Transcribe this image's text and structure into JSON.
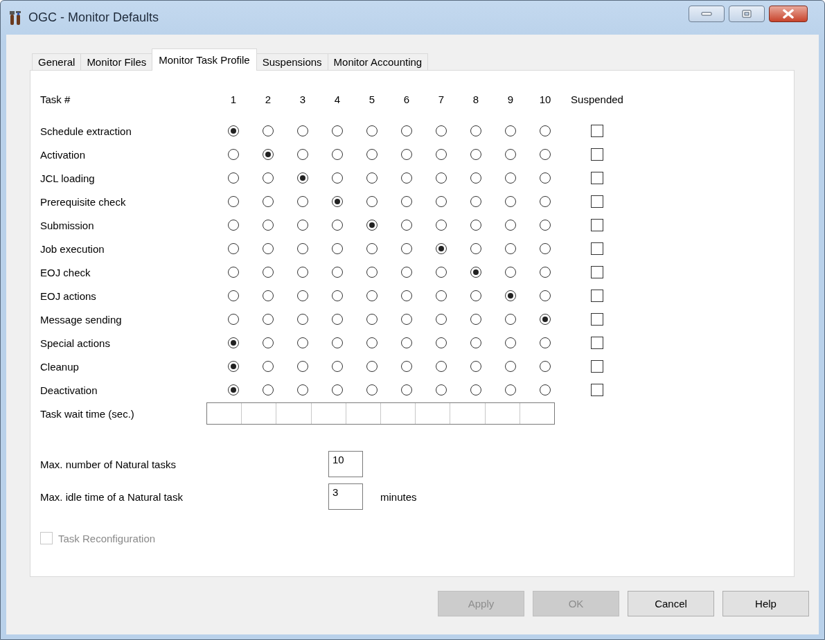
{
  "window": {
    "title": "OGC - Monitor Defaults"
  },
  "tabs": [
    {
      "label": "General",
      "selected": false
    },
    {
      "label": "Monitor Files",
      "selected": false
    },
    {
      "label": "Monitor Task Profile",
      "selected": true
    },
    {
      "label": "Suspensions",
      "selected": false
    },
    {
      "label": "Monitor Accounting",
      "selected": false
    }
  ],
  "task_grid": {
    "header_label": "Task #",
    "task_numbers": [
      "1",
      "2",
      "3",
      "4",
      "5",
      "6",
      "7",
      "8",
      "9",
      "10"
    ],
    "suspended_header": "Suspended",
    "rows": [
      {
        "label": "Schedule extraction",
        "options": [
          {
            "selected": true
          },
          {
            "selected": false
          },
          {
            "selected": false
          },
          {
            "selected": false
          },
          {
            "selected": false
          },
          {
            "selected": false
          },
          {
            "selected": false
          },
          {
            "selected": false
          },
          {
            "selected": false
          },
          {
            "selected": false
          }
        ],
        "suspended": false
      },
      {
        "label": "Activation",
        "options": [
          {
            "selected": false
          },
          {
            "selected": true
          },
          {
            "selected": false
          },
          {
            "selected": false
          },
          {
            "selected": false
          },
          {
            "selected": false
          },
          {
            "selected": false
          },
          {
            "selected": false
          },
          {
            "selected": false
          },
          {
            "selected": false
          }
        ],
        "suspended": false
      },
      {
        "label": "JCL loading",
        "options": [
          {
            "selected": false
          },
          {
            "selected": false
          },
          {
            "selected": true
          },
          {
            "selected": false
          },
          {
            "selected": false
          },
          {
            "selected": false
          },
          {
            "selected": false
          },
          {
            "selected": false
          },
          {
            "selected": false
          },
          {
            "selected": false
          }
        ],
        "suspended": false
      },
      {
        "label": "Prerequisite check",
        "options": [
          {
            "selected": false
          },
          {
            "selected": false
          },
          {
            "selected": false
          },
          {
            "selected": true
          },
          {
            "selected": false
          },
          {
            "selected": false
          },
          {
            "selected": false
          },
          {
            "selected": false
          },
          {
            "selected": false
          },
          {
            "selected": false
          }
        ],
        "suspended": false
      },
      {
        "label": "Submission",
        "options": [
          {
            "selected": false
          },
          {
            "selected": false
          },
          {
            "selected": false
          },
          {
            "selected": false
          },
          {
            "selected": true
          },
          {
            "selected": false
          },
          {
            "selected": false
          },
          {
            "selected": false
          },
          {
            "selected": false
          },
          {
            "selected": false
          }
        ],
        "suspended": false
      },
      {
        "label": "Job execution",
        "options": [
          {
            "selected": false
          },
          {
            "selected": false
          },
          {
            "selected": false
          },
          {
            "selected": false
          },
          {
            "selected": false
          },
          {
            "selected": false
          },
          {
            "selected": true
          },
          {
            "selected": false
          },
          {
            "selected": false
          },
          {
            "selected": false
          }
        ],
        "suspended": false
      },
      {
        "label": "EOJ check",
        "options": [
          {
            "selected": false
          },
          {
            "selected": false
          },
          {
            "selected": false
          },
          {
            "selected": false
          },
          {
            "selected": false
          },
          {
            "selected": false
          },
          {
            "selected": false
          },
          {
            "selected": true
          },
          {
            "selected": false
          },
          {
            "selected": false
          }
        ],
        "suspended": false
      },
      {
        "label": "EOJ actions",
        "options": [
          {
            "selected": false
          },
          {
            "selected": false
          },
          {
            "selected": false
          },
          {
            "selected": false
          },
          {
            "selected": false
          },
          {
            "selected": false
          },
          {
            "selected": false
          },
          {
            "selected": false
          },
          {
            "selected": true
          },
          {
            "selected": false
          }
        ],
        "suspended": false
      },
      {
        "label": "Message sending",
        "options": [
          {
            "selected": false
          },
          {
            "selected": false
          },
          {
            "selected": false
          },
          {
            "selected": false
          },
          {
            "selected": false
          },
          {
            "selected": false
          },
          {
            "selected": false
          },
          {
            "selected": false
          },
          {
            "selected": false
          },
          {
            "selected": true
          }
        ],
        "suspended": false
      },
      {
        "label": "Special actions",
        "options": [
          {
            "selected": true
          },
          {
            "selected": false
          },
          {
            "selected": false
          },
          {
            "selected": false
          },
          {
            "selected": false
          },
          {
            "selected": false
          },
          {
            "selected": false
          },
          {
            "selected": false
          },
          {
            "selected": false
          },
          {
            "selected": false
          }
        ],
        "suspended": false
      },
      {
        "label": "Cleanup",
        "options": [
          {
            "selected": true
          },
          {
            "selected": false
          },
          {
            "selected": false
          },
          {
            "selected": false
          },
          {
            "selected": false
          },
          {
            "selected": false
          },
          {
            "selected": false
          },
          {
            "selected": false
          },
          {
            "selected": false
          },
          {
            "selected": false
          }
        ],
        "suspended": false
      },
      {
        "label": "Deactivation",
        "options": [
          {
            "selected": true
          },
          {
            "selected": false
          },
          {
            "selected": false
          },
          {
            "selected": false
          },
          {
            "selected": false
          },
          {
            "selected": false
          },
          {
            "selected": false
          },
          {
            "selected": false
          },
          {
            "selected": false
          },
          {
            "selected": false
          }
        ],
        "suspended": false
      }
    ],
    "wait_time_label": "Task wait time (sec.)"
  },
  "settings": [
    {
      "label": "Max. number of Natural tasks",
      "value": "10"
    },
    {
      "label": "Max. idle time of a Natural task",
      "value": "3",
      "unit": "minutes"
    }
  ],
  "task_reconfiguration": {
    "label": "Task Reconfiguration",
    "checked": false,
    "disabled": true
  },
  "buttons": [
    {
      "label": "Apply",
      "disabled": true
    },
    {
      "label": "OK",
      "disabled": true
    },
    {
      "label": "Cancel",
      "disabled": false
    },
    {
      "label": "Help",
      "disabled": false
    }
  ]
}
